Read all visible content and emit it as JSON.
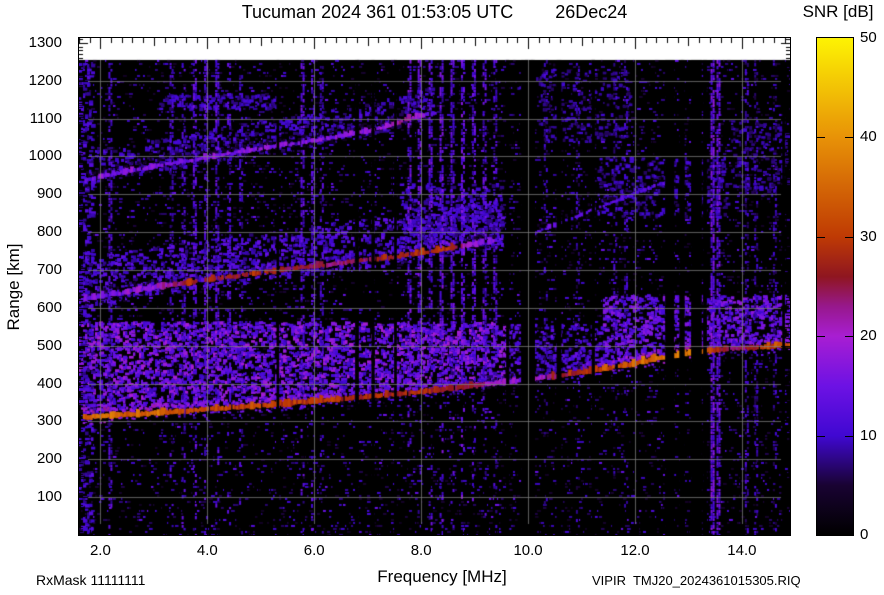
{
  "header": {
    "title": "Tucuman 2024 361 01:53:05 UTC",
    "date": "26Dec24"
  },
  "colorbar": {
    "title": "SNR [dB]",
    "min": 0,
    "max": 50,
    "tick_values": [
      0,
      10,
      20,
      30,
      40,
      50
    ],
    "tick_labels": [
      "0",
      "10",
      "20",
      "30",
      "40",
      "50"
    ],
    "dash_values": [
      10,
      20,
      30,
      40
    ]
  },
  "footer": {
    "rx_mask": "RxMask 11111111",
    "file_label": "VIPIR  TMJ20_2024361015305.RIQ"
  },
  "chart_data": {
    "type": "heatmap",
    "title": "Tucuman 2024 361 01:53:05 UTC  26Dec24",
    "xlabel": "Frequency [MHz]",
    "ylabel": "Range [km]",
    "legend_label": "SNR [dB]",
    "xlim": [
      1.6,
      14.9
    ],
    "ylim": [
      0,
      1313
    ],
    "zlim": [
      0,
      50
    ],
    "grid": true,
    "xticks": [
      2,
      4,
      6,
      8,
      10,
      12,
      14
    ],
    "xtick_labels": [
      "2.0",
      "4.0",
      "6.0",
      "8.0",
      "10.0",
      "12.0",
      "14.0"
    ],
    "yticks": [
      100,
      200,
      300,
      400,
      500,
      600,
      700,
      800,
      900,
      1000,
      1100,
      1200,
      1300
    ],
    "ytick_labels": [
      "100",
      "200",
      "300",
      "400",
      "500",
      "600",
      "700",
      "800",
      "900",
      "1000",
      "1100",
      "1200",
      "1300"
    ],
    "data_top_km": 1255,
    "noise_seed": 9,
    "colormap_stops": [
      [
        0,
        "#000000"
      ],
      [
        5,
        "#190332"
      ],
      [
        10,
        "#4008d2"
      ],
      [
        15,
        "#6d12e4"
      ],
      [
        20,
        "#a81ed2"
      ],
      [
        23,
        "#97188c"
      ],
      [
        26,
        "#8f1620"
      ],
      [
        30,
        "#bf3a04"
      ],
      [
        40,
        "#e89207"
      ],
      [
        50,
        "#fdf303"
      ]
    ],
    "traces": [
      {
        "id": "t1",
        "name": "F-region echo 1st hop",
        "thick": 3.5,
        "gap": 0.04,
        "points": [
          [
            1.6,
            311,
            34
          ],
          [
            2.0,
            314,
            35
          ],
          [
            2.5,
            318,
            33
          ],
          [
            3.0,
            322,
            34
          ],
          [
            3.5,
            327,
            31
          ],
          [
            4.0,
            332,
            32
          ],
          [
            4.5,
            337,
            30
          ],
          [
            5.0,
            342,
            31
          ],
          [
            5.5,
            348,
            29
          ],
          [
            6.0,
            354,
            30
          ],
          [
            6.5,
            360,
            28
          ],
          [
            7.0,
            366,
            28
          ],
          [
            7.5,
            372,
            27
          ],
          [
            8.0,
            379,
            28
          ],
          [
            8.5,
            387,
            26
          ],
          [
            9.0,
            395,
            24
          ],
          [
            9.5,
            403,
            20
          ],
          [
            9.85,
            409,
            16
          ],
          [
            10.15,
            414,
            20
          ],
          [
            10.5,
            420,
            24
          ],
          [
            11.0,
            430,
            27
          ],
          [
            11.5,
            441,
            31
          ],
          [
            12.0,
            454,
            33
          ],
          [
            12.5,
            469,
            35
          ],
          [
            13.0,
            481,
            36
          ],
          [
            13.3,
            487,
            34
          ],
          [
            13.6,
            491,
            26
          ],
          [
            14.0,
            494,
            24
          ],
          [
            14.4,
            497,
            30
          ],
          [
            14.9,
            503,
            33
          ]
        ]
      },
      {
        "id": "t2",
        "name": "F-region echo 2nd hop",
        "thick": 3,
        "gap": 0.12,
        "points": [
          [
            1.6,
            620,
            13
          ],
          [
            2.0,
            632,
            15
          ],
          [
            2.5,
            643,
            16
          ],
          [
            3.0,
            654,
            17
          ],
          [
            3.3,
            661,
            22
          ],
          [
            3.6,
            666,
            26
          ],
          [
            4.0,
            674,
            27
          ],
          [
            4.5,
            684,
            26
          ],
          [
            5.0,
            694,
            28
          ],
          [
            5.5,
            703,
            26
          ],
          [
            6.0,
            711,
            25
          ],
          [
            6.5,
            719,
            24
          ],
          [
            7.0,
            727,
            25
          ],
          [
            7.5,
            735,
            26
          ],
          [
            8.0,
            746,
            28
          ],
          [
            8.4,
            755,
            29
          ],
          [
            8.7,
            762,
            24
          ],
          [
            9.0,
            769,
            18
          ],
          [
            9.4,
            779,
            15
          ]
        ]
      },
      {
        "id": "t3",
        "name": "F-region echo 3rd hop",
        "thick": 2.5,
        "gap": 0.15,
        "points": [
          [
            1.7,
            936,
            13
          ],
          [
            2.0,
            948,
            15
          ],
          [
            2.5,
            961,
            15
          ],
          [
            3.0,
            974,
            16
          ],
          [
            3.5,
            986,
            15
          ],
          [
            4.0,
            998,
            16
          ],
          [
            4.5,
            1010,
            16
          ],
          [
            5.0,
            1022,
            17
          ],
          [
            5.5,
            1032,
            16
          ],
          [
            6.0,
            1043,
            17
          ],
          [
            6.5,
            1055,
            16
          ],
          [
            7.0,
            1068,
            17
          ],
          [
            7.4,
            1082,
            19
          ],
          [
            7.7,
            1098,
            24
          ],
          [
            8.0,
            1108,
            17
          ],
          [
            8.3,
            1116,
            13
          ]
        ]
      },
      {
        "id": "t4",
        "name": "faint oblique echo upper right",
        "thick": 2,
        "gap": 0.3,
        "points": [
          [
            10.1,
            797,
            11
          ],
          [
            10.6,
            826,
            12
          ],
          [
            11.2,
            860,
            13
          ],
          [
            11.8,
            893,
            12
          ],
          [
            12.3,
            920,
            12
          ],
          [
            12.7,
            938,
            11
          ],
          [
            13.2,
            957,
            10
          ]
        ]
      },
      {
        "id": "t5",
        "name": "faint echo top",
        "thick": 2,
        "gap": 0.35,
        "points": [
          [
            9.8,
            1180,
            10
          ],
          [
            10.5,
            1230,
            10
          ]
        ]
      }
    ],
    "spread_regions": [
      {
        "f0": 1.6,
        "f1": 9.6,
        "base": "t1",
        "off0": 8,
        "km1": 565,
        "snr": [
          9,
          20
        ],
        "density": 0.5
      },
      {
        "f0": 9.6,
        "f1": 11.4,
        "base": "t1",
        "off0": 8,
        "km1": 560,
        "snr": [
          8,
          15
        ],
        "density": 0.3
      },
      {
        "f0": 11.4,
        "f1": 14.9,
        "base": "t1",
        "off0": 8,
        "km1": 635,
        "snr": [
          10,
          18
        ],
        "density": 0.45
      },
      {
        "f0": 1.6,
        "f1": 9.5,
        "base": "t2",
        "off0": -18,
        "rel_top": true,
        "off1": 110,
        "snr": [
          7,
          14
        ],
        "density": 0.3
      },
      {
        "f0": 1.9,
        "f1": 8.2,
        "base": "t3",
        "off0": -10,
        "rel_top": true,
        "off1": 75,
        "snr": [
          6,
          12
        ],
        "density": 0.25
      },
      {
        "f0": 3.1,
        "f1": 5.3,
        "km0": 1128,
        "km1": 1168,
        "snr": [
          7,
          12
        ],
        "density": 0.3
      },
      {
        "f0": 11.3,
        "f1": 13.7,
        "km0": 840,
        "km1": 1000,
        "snr": [
          6,
          11
        ],
        "density": 0.22
      },
      {
        "f0": 13.8,
        "f1": 14.85,
        "km0": 900,
        "km1": 1100,
        "snr": [
          6,
          10
        ],
        "density": 0.18
      },
      {
        "f0": 10.2,
        "f1": 11.9,
        "km0": 1040,
        "km1": 1230,
        "snr": [
          6,
          10
        ],
        "density": 0.15
      },
      {
        "f0": 7.6,
        "f1": 9.5,
        "km0": 780,
        "km1": 930,
        "snr": [
          7,
          12
        ],
        "density": 0.25
      },
      {
        "f0": 1.6,
        "f1": 1.85,
        "km0": 0,
        "km1": 1250,
        "snr": [
          7,
          13
        ],
        "density": 0.3
      }
    ],
    "rfi_bright_columns": [
      {
        "f": 2.18,
        "w": 0.06,
        "snr": 12,
        "dens": 0.5,
        "full": 1
      },
      {
        "f": 3.32,
        "w": 0.05,
        "snr": 11,
        "dens": 0.4,
        "full": 0
      },
      {
        "f": 3.55,
        "w": 0.06,
        "snr": 12,
        "dens": 0.5,
        "full": 0
      },
      {
        "f": 3.76,
        "w": 0.06,
        "snr": 13,
        "dens": 0.5,
        "full": 0
      },
      {
        "f": 3.97,
        "w": 0.06,
        "snr": 12,
        "dens": 0.5,
        "full": 0
      },
      {
        "f": 4.18,
        "w": 0.06,
        "snr": 13,
        "dens": 0.55,
        "full": 0
      },
      {
        "f": 4.4,
        "w": 0.06,
        "snr": 12,
        "dens": 0.5,
        "full": 0
      },
      {
        "f": 4.62,
        "w": 0.05,
        "snr": 11,
        "dens": 0.4,
        "full": 0
      },
      {
        "f": 5.78,
        "w": 0.07,
        "snr": 13,
        "dens": 0.55,
        "full": 0
      },
      {
        "f": 5.97,
        "w": 0.06,
        "snr": 12,
        "dens": 0.5,
        "full": 0
      },
      {
        "f": 6.13,
        "w": 0.05,
        "snr": 11,
        "dens": 0.4,
        "full": 0
      },
      {
        "f": 7.78,
        "w": 0.07,
        "snr": 14,
        "dens": 0.6,
        "full": 0
      },
      {
        "f": 7.97,
        "w": 0.07,
        "snr": 14,
        "dens": 0.6,
        "full": 0
      },
      {
        "f": 8.17,
        "w": 0.06,
        "snr": 13,
        "dens": 0.6,
        "full": 0
      },
      {
        "f": 8.38,
        "w": 0.07,
        "snr": 14,
        "dens": 0.65,
        "full": 0
      },
      {
        "f": 8.58,
        "w": 0.06,
        "snr": 13,
        "dens": 0.6,
        "full": 0
      },
      {
        "f": 8.78,
        "w": 0.07,
        "snr": 14,
        "dens": 0.6,
        "full": 0
      },
      {
        "f": 8.98,
        "w": 0.06,
        "snr": 13,
        "dens": 0.6,
        "full": 0
      },
      {
        "f": 9.18,
        "w": 0.06,
        "snr": 13,
        "dens": 0.55,
        "full": 0
      },
      {
        "f": 9.38,
        "w": 0.06,
        "snr": 12,
        "dens": 0.5,
        "full": 0
      },
      {
        "f": 10.32,
        "w": 0.05,
        "snr": 9,
        "dens": 0.3,
        "full": 0
      },
      {
        "f": 10.92,
        "w": 0.05,
        "snr": 9,
        "dens": 0.3,
        "full": 0
      },
      {
        "f": 11.62,
        "w": 0.05,
        "snr": 10,
        "dens": 0.35,
        "full": 0
      },
      {
        "f": 11.82,
        "w": 0.05,
        "snr": 10,
        "dens": 0.35,
        "full": 0
      },
      {
        "f": 13.44,
        "w": 0.05,
        "snr": 15,
        "dens": 0.8,
        "full": 1
      },
      {
        "f": 13.55,
        "w": 0.05,
        "snr": 14,
        "dens": 0.7,
        "full": 1
      },
      {
        "f": 14.08,
        "w": 0.05,
        "snr": 10,
        "dens": 0.4,
        "full": 1
      },
      {
        "f": 14.25,
        "w": 0.04,
        "snr": 9,
        "dens": 0.35,
        "full": 1
      },
      {
        "f": 14.6,
        "w": 0.04,
        "snr": 9,
        "dens": 0.3,
        "full": 1
      }
    ],
    "rfi_dark_columns": [
      {
        "f": 5.32,
        "w": 0.05
      },
      {
        "f": 6.8,
        "w": 0.07
      },
      {
        "f": 7.1,
        "w": 0.06
      },
      {
        "f": 7.52,
        "w": 0.05
      },
      {
        "f": 9.62,
        "w": 0.06
      },
      {
        "f": 10.0,
        "w": 0.26
      },
      {
        "f": 10.58,
        "w": 0.09
      },
      {
        "f": 11.22,
        "w": 0.06
      },
      {
        "f": 12.65,
        "w": 0.17
      },
      {
        "f": 12.88,
        "w": 0.1
      },
      {
        "f": 13.15,
        "w": 0.2
      },
      {
        "f": 13.31,
        "w": 0.07
      },
      {
        "f": 14.78,
        "w": 0.05
      }
    ]
  }
}
